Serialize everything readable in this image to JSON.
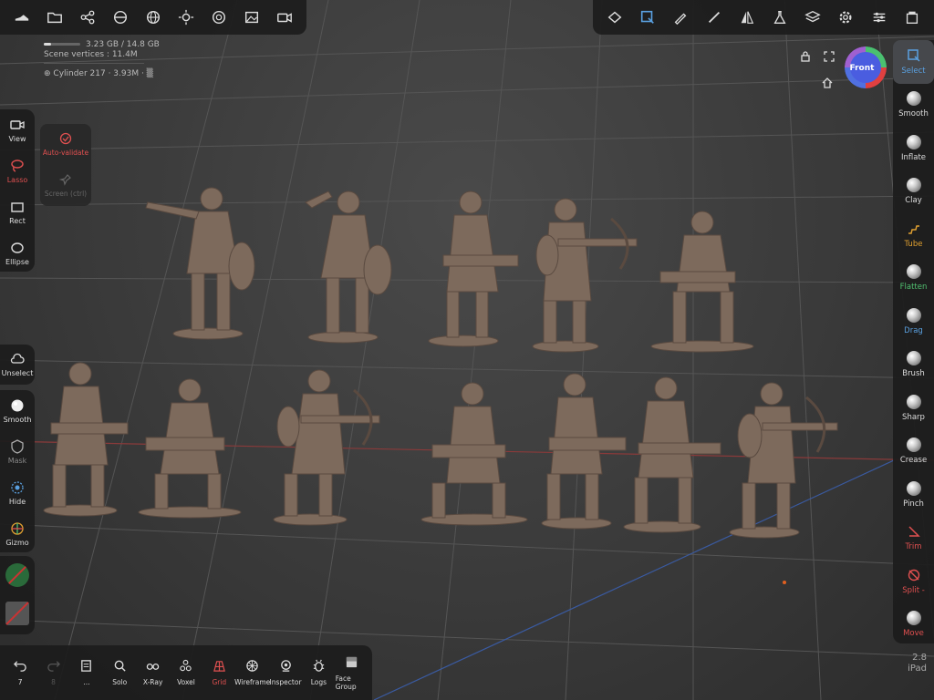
{
  "app": {
    "version": "2.8",
    "device": "iPad"
  },
  "topbar_left": {
    "icons": [
      "shoe-icon",
      "folder-icon",
      "share-nodes-icon",
      "shading-icon",
      "globe-icon",
      "sun-icon",
      "aperture-icon",
      "image-icon",
      "video-camera-icon"
    ]
  },
  "topbar_right": {
    "icons": [
      "eraser-mesh-icon",
      "select-tool-icon",
      "pencil-icon",
      "brush-icon",
      "mirror-icon",
      "flask-icon",
      "layers-icon",
      "gear-icon",
      "sliders-icon",
      "cards-icon"
    ]
  },
  "stats": {
    "memory": "3.23 GB / 14.8 GB",
    "scene_vertices": "Scene vertices : 11.4M",
    "object": "Cylinder 217 · 3.93M ·"
  },
  "gizmo": {
    "label": "Front"
  },
  "left_tools": [
    {
      "label": "View",
      "icon": "camera-icon"
    },
    {
      "label": "Lasso",
      "icon": "lasso-icon",
      "active": true
    },
    {
      "label": "Rect",
      "icon": "rectangle-icon"
    },
    {
      "label": "Ellipse",
      "icon": "ellipse-icon"
    }
  ],
  "sub_panel": [
    {
      "label": "Auto-validate",
      "icon": "check-circle-icon"
    },
    {
      "label": "Screen (ctrl)",
      "icon": "pin-icon"
    }
  ],
  "left_mid": {
    "label": "Unselect",
    "icon": "cloud-icon"
  },
  "left_low": [
    {
      "label": "Smooth",
      "icon": "smooth-ball-icon"
    },
    {
      "label": "Mask",
      "icon": "mask-shield-icon"
    },
    {
      "label": "Hide",
      "icon": "hide-grid-icon"
    },
    {
      "label": "Gizmo",
      "icon": "gizmo-icon"
    }
  ],
  "right_tools": [
    {
      "label": "Select",
      "active": true
    },
    {
      "label": "Smooth"
    },
    {
      "label": "Inflate"
    },
    {
      "label": "Clay"
    },
    {
      "label": "Tube",
      "color": "#e0a030"
    },
    {
      "label": "Flatten",
      "color": "#50c070"
    },
    {
      "label": "Drag",
      "color": "#5aa0e0"
    },
    {
      "label": "Brush"
    },
    {
      "label": "Sharp"
    },
    {
      "label": "Crease"
    },
    {
      "label": "Pinch"
    },
    {
      "label": "Trim",
      "color": "#e05050"
    },
    {
      "label": "Split -",
      "color": "#e05050"
    },
    {
      "label": "Move",
      "color": "#e05050"
    }
  ],
  "bottom_bar": [
    {
      "label": "7",
      "icon": "undo-icon"
    },
    {
      "label": "8",
      "icon": "redo-icon"
    },
    {
      "label": "...",
      "icon": "document-icon"
    },
    {
      "label": "Solo",
      "icon": "search-icon"
    },
    {
      "label": "X-Ray",
      "icon": "glasses-icon"
    },
    {
      "label": "Voxel",
      "icon": "voxel-icon"
    },
    {
      "label": "Grid",
      "icon": "grid-icon",
      "active": true
    },
    {
      "label": "Wireframe",
      "icon": "wireframe-icon"
    },
    {
      "label": "Inspector",
      "icon": "inspector-icon"
    },
    {
      "label": "Logs",
      "icon": "bug-icon"
    },
    {
      "label": "Face Group",
      "icon": "face-group-icon"
    }
  ],
  "colors": {
    "accent_select": "#5aa0e0",
    "active_red": "#e05050",
    "figure": "#7d6a5c"
  }
}
